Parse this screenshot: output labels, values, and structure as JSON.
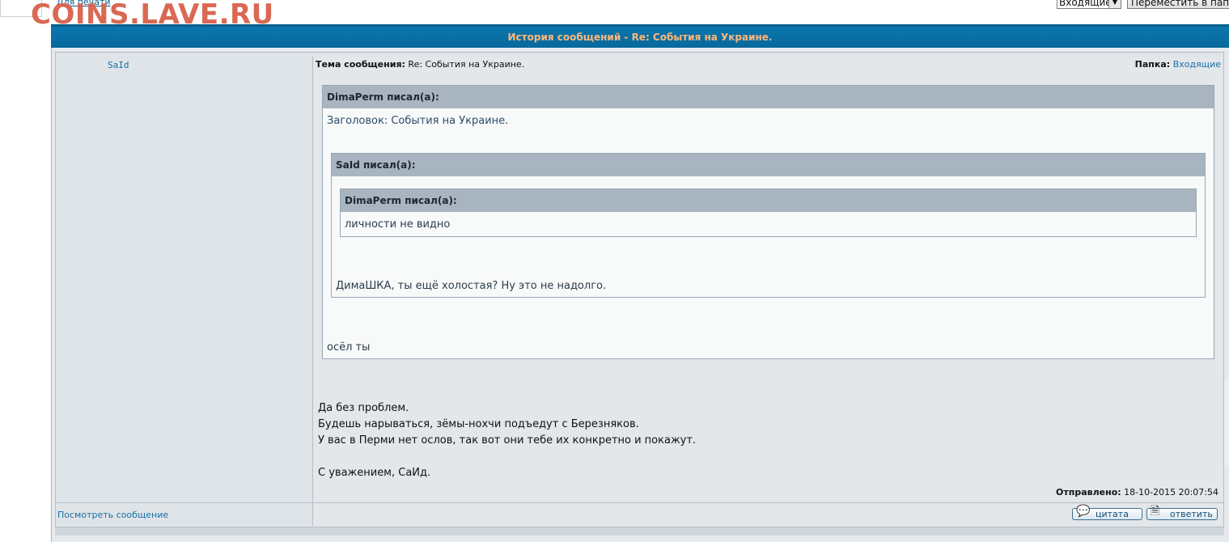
{
  "top": {
    "print_link": "Для печати",
    "watermark": "COINS.LAVE.RU",
    "folder_select": "Входящие",
    "move_button": "Переместить в папку"
  },
  "header": {
    "title": "История сообщений - Re: События на Украине."
  },
  "message": {
    "author": "SaId",
    "subject_label": "Тема сообщения:",
    "subject_value": "Re: События на Украине.",
    "folder_label": "Папка:",
    "folder_value": "Входящие",
    "quote1": {
      "head": "DimaPerm писал(а):",
      "line1": "Заголовок: События на Украине.",
      "tail": "осёл ты"
    },
    "quote2": {
      "head": "SaId писал(а):",
      "tail": "ДимаШКА, ты ещё холостая? Ну это не надолго."
    },
    "quote3": {
      "head": "DimaPerm писал(а):",
      "line1": "личности не видно"
    },
    "body": [
      "Да без проблем.",
      "Будешь нарываться, зёмы-нохчи подъедут с Березняков.",
      "У вас в Перми нет ослов, так вот они тебе их конкретно и покажут.",
      "С уважением, СаИд."
    ],
    "sent_label": "Отправлено:",
    "sent_value": "18-10-2015 20:07:54"
  },
  "footer": {
    "view_message": "Посмотреть сообщение",
    "quote_button": "цитата",
    "reply_button": "ответить"
  }
}
